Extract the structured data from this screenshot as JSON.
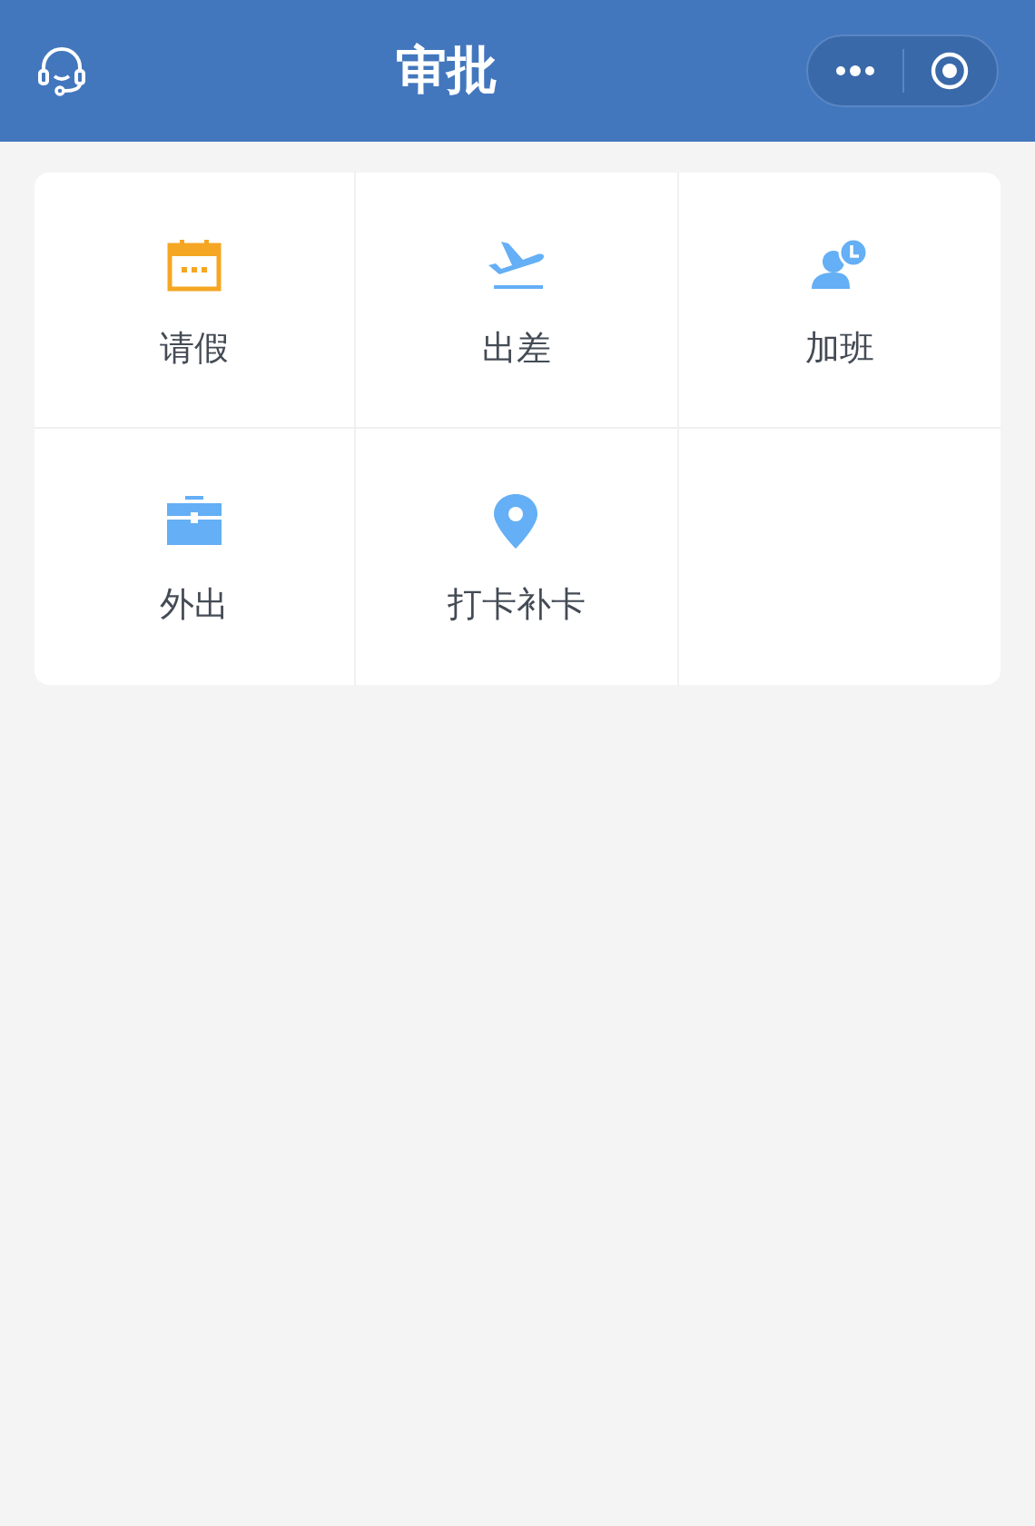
{
  "header": {
    "title": "审批"
  },
  "items": [
    {
      "kind": "calendar",
      "label": "请假"
    },
    {
      "kind": "plane",
      "label": "出差"
    },
    {
      "kind": "person-clock",
      "label": "加班"
    },
    {
      "kind": "briefcase",
      "label": "外出"
    },
    {
      "kind": "pin",
      "label": "打卡补卡"
    }
  ]
}
